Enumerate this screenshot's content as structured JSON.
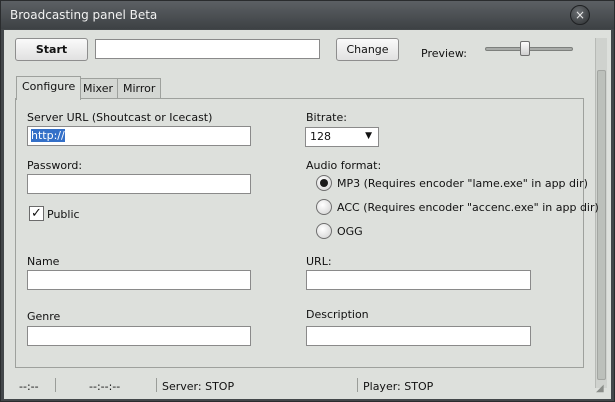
{
  "window": {
    "title": "Broadcasting panel  Beta",
    "close_glyph": "×"
  },
  "toolbar": {
    "start_label": "Start",
    "name_value": "",
    "change_label": "Change",
    "preview_label": "Preview:",
    "preview_level": 0.45
  },
  "tabs": [
    {
      "label": "Configure",
      "active": true
    },
    {
      "label": "Mixer",
      "active": false
    },
    {
      "label": "Mirror",
      "active": false
    }
  ],
  "config": {
    "server_url_label": "Server URL (Shoutcast or Icecast)",
    "server_url_value": "http://",
    "password_label": "Password:",
    "password_value": "",
    "public_label": "Public",
    "public_checked": true,
    "check_glyph": "✓",
    "name_label": "Name",
    "name_value": "",
    "genre_label": "Genre",
    "genre_value": "",
    "bitrate_label": "Bitrate:",
    "bitrate_value": "128",
    "dropdown_glyph": "▼",
    "audio_format_label": "Audio format:",
    "formats": [
      {
        "label": "MP3 (Requires encoder \"lame.exe\" in app dir)",
        "checked": true
      },
      {
        "label": "ACC (Requires encoder \"accenc.exe\" in app dir)",
        "checked": false
      },
      {
        "label": "OGG",
        "checked": false
      }
    ],
    "url_label": "URL:",
    "url_value": "",
    "description_label": "Description",
    "description_value": ""
  },
  "status": {
    "time1": "--:--",
    "time2": "--:--:--",
    "server": "Server: STOP",
    "player": "Player: STOP",
    "grip_glyph": "◢"
  }
}
